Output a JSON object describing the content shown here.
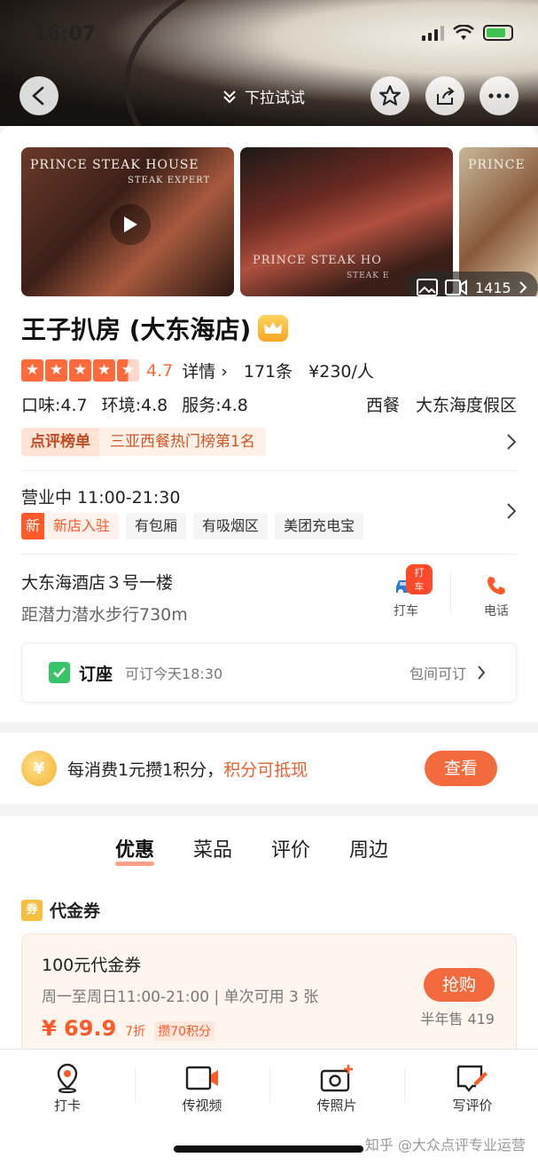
{
  "status_bar": {
    "time": "16:07"
  },
  "nav": {
    "pull_hint": "下拉试试"
  },
  "photos": {
    "brand_1": "PRINCE STEAK HOUSE",
    "brand_1_sub": "STEAK EXPERT",
    "brand_2": "PRINCE STEAK HO",
    "brand_2_sub": "STEAK E",
    "brand_3": "PRINCE",
    "count": "1415"
  },
  "shop": {
    "name": "王子扒房 (大东海店)",
    "score": "4.7",
    "detail_link": "详情",
    "reviews": "171条",
    "price": "¥230/人",
    "taste": "口味:4.7",
    "environment": "环境:4.8",
    "service": "服务:4.8",
    "category": "西餐",
    "area": "大东海度假区"
  },
  "rank": {
    "tag": "点评榜单",
    "text": "三亚西餐热门榜第1名"
  },
  "hours": "营业中 11:00-21:30",
  "tags": {
    "new_mark": "新",
    "new_text": "新店入驻",
    "t1": "有包厢",
    "t2": "有吸烟区",
    "t3": "美团充电宝"
  },
  "location": {
    "address": "大东海酒店３号一楼",
    "distance": "距潜力潜水步行730m",
    "taxi_badge": "打车",
    "taxi_label": "打车",
    "call_label": "电话"
  },
  "booking": {
    "title": "订座",
    "time": "可订今天18:30",
    "room": "包间可订"
  },
  "points": {
    "coin_label": "¥",
    "text": "每消费1元攒1积分，",
    "highlight": "积分可抵现",
    "button": "查看"
  },
  "tabs": [
    "优惠",
    "菜品",
    "评价",
    "周边"
  ],
  "coupon": {
    "section_icon": "券",
    "section_title": "代金券",
    "name": "100元代金券",
    "rule": "周一至周日11:00-21:00 | 单次可用 3 张",
    "price": "¥ 69.9",
    "discount": "7折",
    "points": "攒70积分",
    "button": "抢购",
    "sold": "半年售 419"
  },
  "bottom_bar": {
    "checkin": "打卡",
    "video": "传视频",
    "photo": "传照片",
    "review": "写评价"
  },
  "watermark": "知乎 @大众点评专业运营",
  "colors": {
    "accent": "#ff5a2a",
    "star": "#ff6a3d",
    "button": "#f26a3d",
    "check": "#37c46a"
  }
}
